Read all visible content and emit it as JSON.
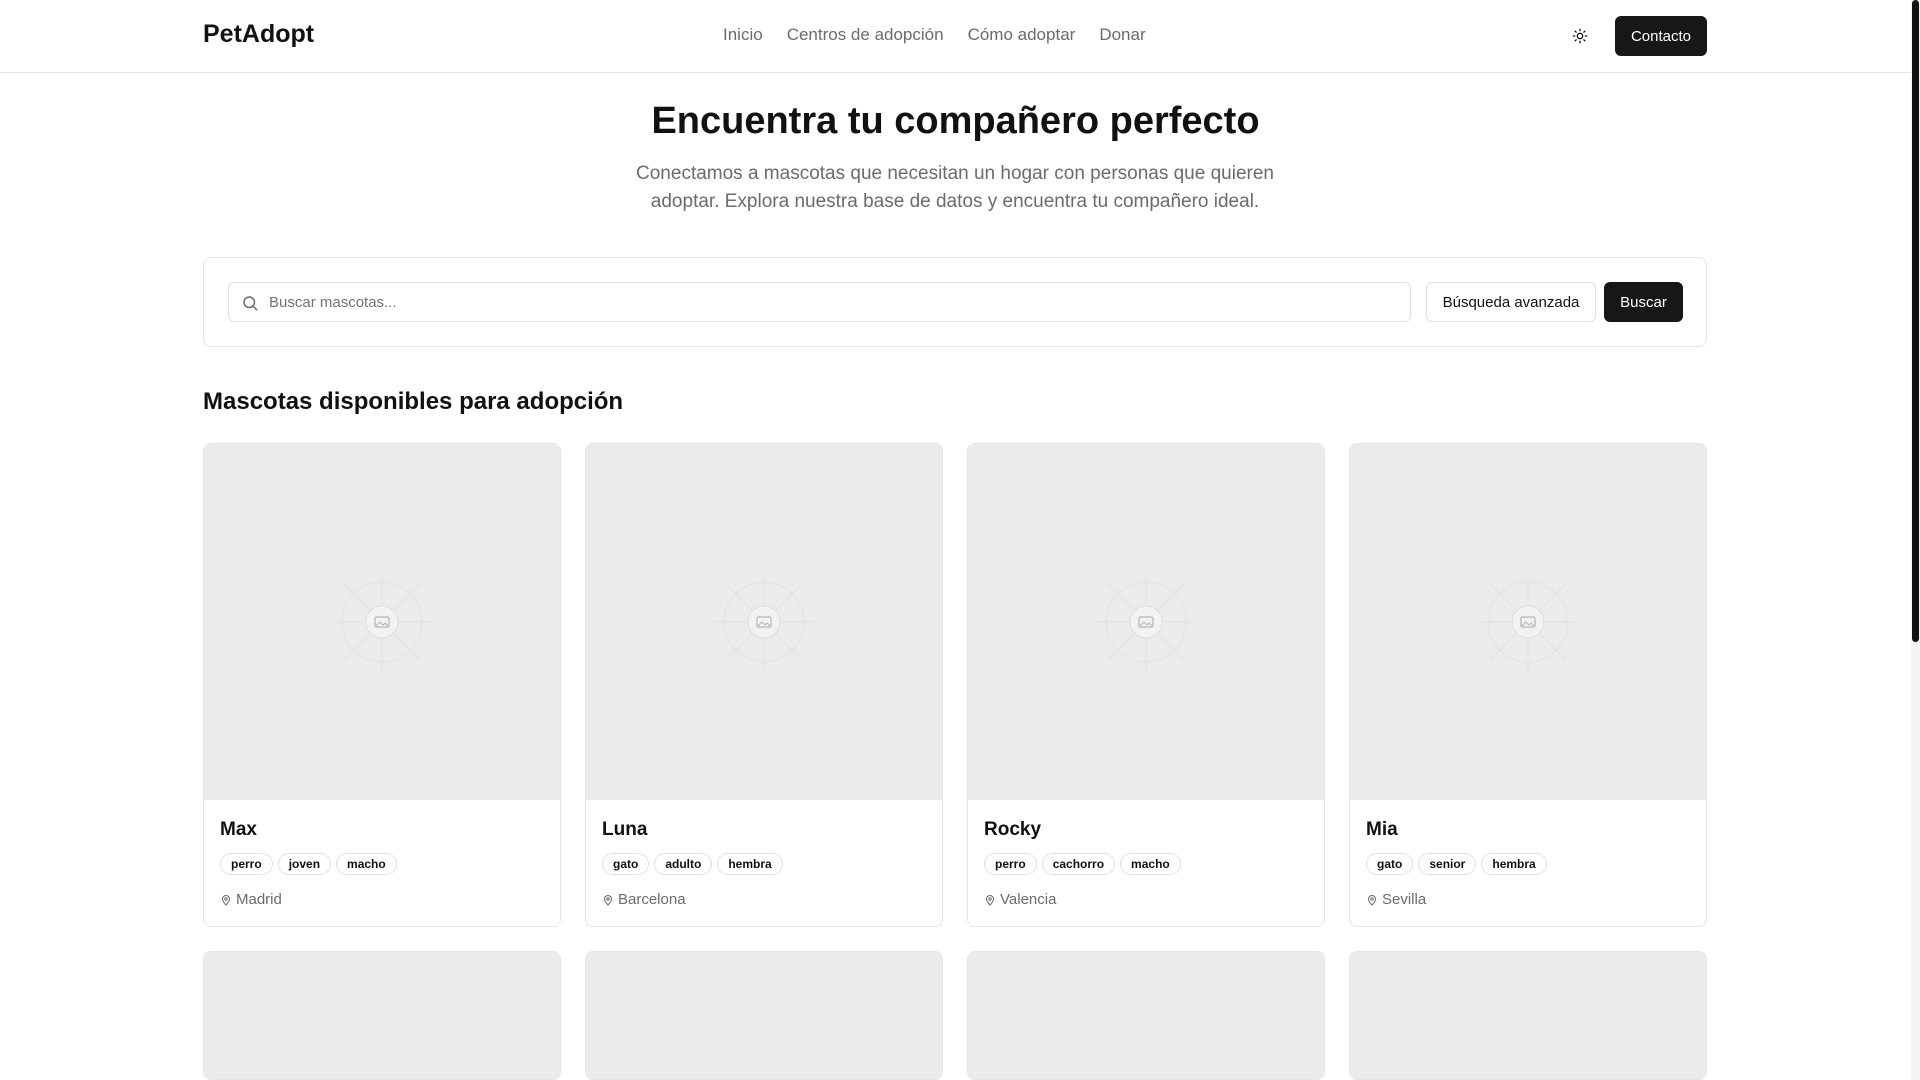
{
  "header": {
    "brand": "PetAdopt",
    "nav": [
      "Inicio",
      "Centros de adopción",
      "Cómo adoptar",
      "Donar"
    ],
    "contact_label": "Contacto"
  },
  "hero": {
    "title": "Encuentra tu compañero perfecto",
    "subtitle": "Conectamos a mascotas que necesitan un hogar con personas que quieren adoptar. Explora nuestra base de datos y encuentra tu compañero ideal."
  },
  "search": {
    "placeholder": "Buscar mascotas...",
    "advanced_label": "Búsqueda avanzada",
    "search_label": "Buscar"
  },
  "section": {
    "title": "Mascotas disponibles para adopción"
  },
  "pets": [
    {
      "name": "Max",
      "tags": [
        "perro",
        "joven",
        "macho"
      ],
      "location": "Madrid"
    },
    {
      "name": "Luna",
      "tags": [
        "gato",
        "adulto",
        "hembra"
      ],
      "location": "Barcelona"
    },
    {
      "name": "Rocky",
      "tags": [
        "perro",
        "cachorro",
        "macho"
      ],
      "location": "Valencia"
    },
    {
      "name": "Mia",
      "tags": [
        "gato",
        "senior",
        "hembra"
      ],
      "location": "Sevilla"
    }
  ],
  "icons": {
    "theme": "sun-icon",
    "search": "search-icon",
    "placeholder": "image-placeholder-icon",
    "location": "map-pin-icon"
  }
}
